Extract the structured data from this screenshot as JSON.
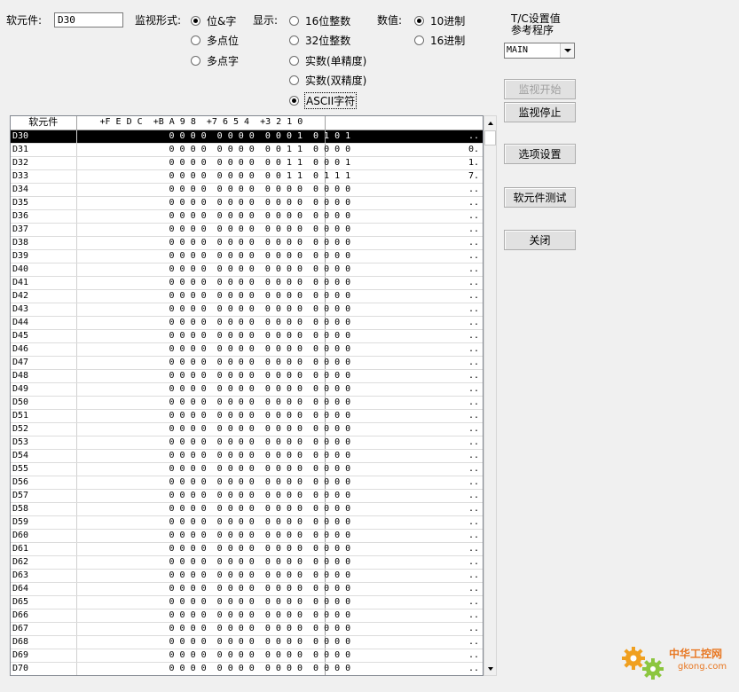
{
  "device_field": {
    "label": "软元件:",
    "value": "D30"
  },
  "monitor_format": {
    "label": "监视形式:",
    "options": [
      {
        "label": "位&字",
        "selected": true
      },
      {
        "label": "多点位",
        "selected": false
      },
      {
        "label": "多点字",
        "selected": false
      }
    ]
  },
  "display": {
    "label": "显示:",
    "options": [
      {
        "label": "16位整数",
        "selected": false
      },
      {
        "label": "32位整数",
        "selected": false
      },
      {
        "label": "实数(单精度)",
        "selected": false
      },
      {
        "label": "实数(双精度)",
        "selected": false
      },
      {
        "label": "ASCII字符",
        "selected": true
      }
    ]
  },
  "numeric": {
    "label": "数值:",
    "options": [
      {
        "label": "10进制",
        "selected": true
      },
      {
        "label": "16进制",
        "selected": false
      }
    ]
  },
  "tc_setting": {
    "label_line1": "T/C设置值",
    "label_line2": "参考程序",
    "program": "MAIN"
  },
  "buttons": {
    "monitor_start": "监视开始",
    "monitor_stop": "监视停止",
    "options": "选项设置",
    "device_test": "软元件测试",
    "close": "关闭"
  },
  "grid": {
    "headers": {
      "device": "软元件",
      "bits": "+F E D C  +B A 9 8  +7 6 5 4  +3 2 1 0",
      "value": ""
    },
    "rows": [
      {
        "device": "D30",
        "bits": "0 0 0 0  0 0 0 0  0 0 0 1  0 1 0 1",
        "value": "..",
        "selected": true
      },
      {
        "device": "D31",
        "bits": "0 0 0 0  0 0 0 0  0 0 1 1  0 0 0 0",
        "value": "0."
      },
      {
        "device": "D32",
        "bits": "0 0 0 0  0 0 0 0  0 0 1 1  0 0 0 1",
        "value": "1."
      },
      {
        "device": "D33",
        "bits": "0 0 0 0  0 0 0 0  0 0 1 1  0 1 1 1",
        "value": "7."
      },
      {
        "device": "D34",
        "bits": "0 0 0 0  0 0 0 0  0 0 0 0  0 0 0 0",
        "value": ".."
      },
      {
        "device": "D35",
        "bits": "0 0 0 0  0 0 0 0  0 0 0 0  0 0 0 0",
        "value": ".."
      },
      {
        "device": "D36",
        "bits": "0 0 0 0  0 0 0 0  0 0 0 0  0 0 0 0",
        "value": ".."
      },
      {
        "device": "D37",
        "bits": "0 0 0 0  0 0 0 0  0 0 0 0  0 0 0 0",
        "value": ".."
      },
      {
        "device": "D38",
        "bits": "0 0 0 0  0 0 0 0  0 0 0 0  0 0 0 0",
        "value": ".."
      },
      {
        "device": "D39",
        "bits": "0 0 0 0  0 0 0 0  0 0 0 0  0 0 0 0",
        "value": ".."
      },
      {
        "device": "D40",
        "bits": "0 0 0 0  0 0 0 0  0 0 0 0  0 0 0 0",
        "value": ".."
      },
      {
        "device": "D41",
        "bits": "0 0 0 0  0 0 0 0  0 0 0 0  0 0 0 0",
        "value": ".."
      },
      {
        "device": "D42",
        "bits": "0 0 0 0  0 0 0 0  0 0 0 0  0 0 0 0",
        "value": ".."
      },
      {
        "device": "D43",
        "bits": "0 0 0 0  0 0 0 0  0 0 0 0  0 0 0 0",
        "value": ".."
      },
      {
        "device": "D44",
        "bits": "0 0 0 0  0 0 0 0  0 0 0 0  0 0 0 0",
        "value": ".."
      },
      {
        "device": "D45",
        "bits": "0 0 0 0  0 0 0 0  0 0 0 0  0 0 0 0",
        "value": ".."
      },
      {
        "device": "D46",
        "bits": "0 0 0 0  0 0 0 0  0 0 0 0  0 0 0 0",
        "value": ".."
      },
      {
        "device": "D47",
        "bits": "0 0 0 0  0 0 0 0  0 0 0 0  0 0 0 0",
        "value": ".."
      },
      {
        "device": "D48",
        "bits": "0 0 0 0  0 0 0 0  0 0 0 0  0 0 0 0",
        "value": ".."
      },
      {
        "device": "D49",
        "bits": "0 0 0 0  0 0 0 0  0 0 0 0  0 0 0 0",
        "value": ".."
      },
      {
        "device": "D50",
        "bits": "0 0 0 0  0 0 0 0  0 0 0 0  0 0 0 0",
        "value": ".."
      },
      {
        "device": "D51",
        "bits": "0 0 0 0  0 0 0 0  0 0 0 0  0 0 0 0",
        "value": ".."
      },
      {
        "device": "D52",
        "bits": "0 0 0 0  0 0 0 0  0 0 0 0  0 0 0 0",
        "value": ".."
      },
      {
        "device": "D53",
        "bits": "0 0 0 0  0 0 0 0  0 0 0 0  0 0 0 0",
        "value": ".."
      },
      {
        "device": "D54",
        "bits": "0 0 0 0  0 0 0 0  0 0 0 0  0 0 0 0",
        "value": ".."
      },
      {
        "device": "D55",
        "bits": "0 0 0 0  0 0 0 0  0 0 0 0  0 0 0 0",
        "value": ".."
      },
      {
        "device": "D56",
        "bits": "0 0 0 0  0 0 0 0  0 0 0 0  0 0 0 0",
        "value": ".."
      },
      {
        "device": "D57",
        "bits": "0 0 0 0  0 0 0 0  0 0 0 0  0 0 0 0",
        "value": ".."
      },
      {
        "device": "D58",
        "bits": "0 0 0 0  0 0 0 0  0 0 0 0  0 0 0 0",
        "value": ".."
      },
      {
        "device": "D59",
        "bits": "0 0 0 0  0 0 0 0  0 0 0 0  0 0 0 0",
        "value": ".."
      },
      {
        "device": "D60",
        "bits": "0 0 0 0  0 0 0 0  0 0 0 0  0 0 0 0",
        "value": ".."
      },
      {
        "device": "D61",
        "bits": "0 0 0 0  0 0 0 0  0 0 0 0  0 0 0 0",
        "value": ".."
      },
      {
        "device": "D62",
        "bits": "0 0 0 0  0 0 0 0  0 0 0 0  0 0 0 0",
        "value": ".."
      },
      {
        "device": "D63",
        "bits": "0 0 0 0  0 0 0 0  0 0 0 0  0 0 0 0",
        "value": ".."
      },
      {
        "device": "D64",
        "bits": "0 0 0 0  0 0 0 0  0 0 0 0  0 0 0 0",
        "value": ".."
      },
      {
        "device": "D65",
        "bits": "0 0 0 0  0 0 0 0  0 0 0 0  0 0 0 0",
        "value": ".."
      },
      {
        "device": "D66",
        "bits": "0 0 0 0  0 0 0 0  0 0 0 0  0 0 0 0",
        "value": ".."
      },
      {
        "device": "D67",
        "bits": "0 0 0 0  0 0 0 0  0 0 0 0  0 0 0 0",
        "value": ".."
      },
      {
        "device": "D68",
        "bits": "0 0 0 0  0 0 0 0  0 0 0 0  0 0 0 0",
        "value": ".."
      },
      {
        "device": "D69",
        "bits": "0 0 0 0  0 0 0 0  0 0 0 0  0 0 0 0",
        "value": ".."
      },
      {
        "device": "D70",
        "bits": "0 0 0 0  0 0 0 0  0 0 0 0  0 0 0 0",
        "value": ".."
      }
    ]
  },
  "watermark": {
    "brand": "中华工控网",
    "site": "gkong.com"
  },
  "colors": {
    "selected_row_bg": "#000000",
    "watermark": "#e87722",
    "dialog_bg": "#f0f0f0"
  }
}
